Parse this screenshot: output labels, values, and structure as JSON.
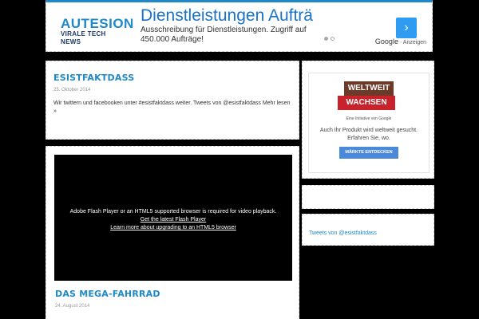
{
  "header": {
    "logo_line1": "AUTESION",
    "logo_line2": "VIRALE TECH NEWS",
    "ad": {
      "headline": "Dienstleistungen Aufträ",
      "description": "Ausschreibung für Dienstleistungen. Zugriff auf 450.000 Aufträge!",
      "arrow": "›",
      "google_label": "Google",
      "anzeigen_label": "Anzeigen"
    }
  },
  "posts": [
    {
      "title": "ESISTFAKTDASS",
      "date": "25. Oktober 2014",
      "excerpt": "Wir twittern und facebooken unter #esistfaktdass weiter. Tweets von @esistfaktdass Mehr lesen »"
    },
    {
      "title": "DAS MEGA-FAHRRAD",
      "date": "24. August 2014",
      "video": {
        "line1": "Adobe Flash Player or an HTML5 supported browser is required for video playback.",
        "link1": "Get the latest Flash Player",
        "link2": "Learn more about upgrading to an HTML5 browser"
      }
    }
  ],
  "sidebar": {
    "ad": {
      "brand_line1": "WELTWEIT",
      "brand_line2": "WACHSEN",
      "initiative": "Eine Initiative von Google",
      "text": "Auch Ihr Produkt wird weltweit gesucht. Erfahren Sie, wo.",
      "button": "MÄRKTE ENTDECKEN"
    },
    "tweets_link": "Tweets von @esistfaktdass"
  },
  "colors": {
    "accent": "#1e88c8",
    "background": "#000000",
    "ad_red": "#c8232c",
    "ad_brown": "#6d3a2a"
  }
}
